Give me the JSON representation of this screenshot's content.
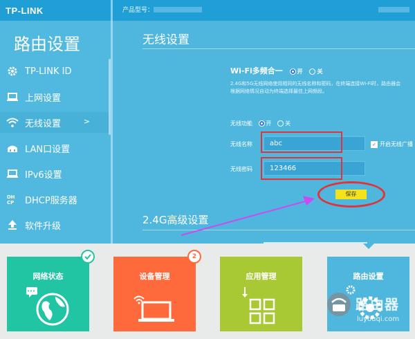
{
  "header": {
    "logo": "TP-LINK",
    "model_label": "产品型号："
  },
  "sidebar": {
    "title": "路由设置",
    "items": [
      {
        "label": "TP-LINK ID",
        "icon": "gear-icon"
      },
      {
        "label": "上网设置",
        "icon": "laptop-icon"
      },
      {
        "label": "无线设置",
        "icon": "wifi-icon",
        "active": true,
        "arrow": ">"
      },
      {
        "label": "LAN口设置",
        "icon": "network-icon"
      },
      {
        "label": "IPv6设置",
        "icon": "monitor-icon"
      },
      {
        "label": "DHCP服务器",
        "icon": "dhcp-icon"
      },
      {
        "label": "软件升级",
        "icon": "upload-icon"
      }
    ]
  },
  "main": {
    "section_title": "无线设置",
    "wifi_multi": {
      "label": "Wi-Fi多频合一",
      "on": "开",
      "off": "关",
      "selected": "开",
      "description": "2.4G和5G无线网络使用相同的无线名称和密码，在终端连接Wi-Fi时，路由器会根据网络情况自动为终端选择最佳上网频段。"
    },
    "wireless_function": {
      "label": "无线功能",
      "on": "开",
      "off": "关",
      "selected": "开"
    },
    "ssid": {
      "label": "无线名称",
      "value": "abc",
      "broadcast_label": "开启无线广播",
      "broadcast_checked": true
    },
    "password": {
      "label": "无线密码",
      "value": "123466"
    },
    "save_label": "保存",
    "advanced_title": "2.4G高级设置"
  },
  "tiles": [
    {
      "label": "网络状态",
      "color": "#21c4a3",
      "badge": "check"
    },
    {
      "label": "设备管理",
      "color": "#ff6a3d",
      "badge": "2"
    },
    {
      "label": "应用管理",
      "color": "#a8c934",
      "badge": ""
    },
    {
      "label": "路由设置",
      "color": "#4fb7dd",
      "badge": ""
    }
  ],
  "watermark": {
    "text": "路由器",
    "url": "luyouqi.com"
  },
  "colors": {
    "accent": "#1f9fd6",
    "panel": "#4fb7dd",
    "highlight_red": "#e0343a",
    "annotation_arrow": "#c84cf0",
    "save_button": "#f4e21a"
  }
}
